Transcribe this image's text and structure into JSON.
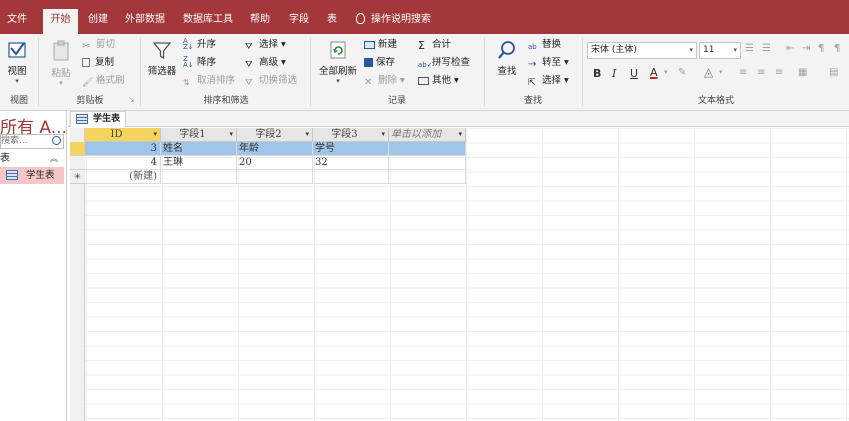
{
  "tabs": [
    {
      "label": "文件",
      "active": false
    },
    {
      "label": "开始",
      "active": true
    },
    {
      "label": "创建",
      "active": false
    },
    {
      "label": "外部数据",
      "active": false
    },
    {
      "label": "数据库工具",
      "active": false
    },
    {
      "label": "帮助",
      "active": false
    },
    {
      "label": "字段",
      "active": false
    },
    {
      "label": "表",
      "active": false
    }
  ],
  "tell_me": "操作说明搜索",
  "ribbon": {
    "views": {
      "view": "视图",
      "group": "视图"
    },
    "clipboard": {
      "paste": "粘贴",
      "cut": "剪切",
      "copy": "复制",
      "format_painter": "格式刷",
      "group": "剪贴板"
    },
    "sort_filter": {
      "filter": "筛选器",
      "ascending": "升序",
      "descending": "降序",
      "remove_sort": "取消排序",
      "selection": "选择",
      "advanced": "高级",
      "toggle_filter": "切换筛选",
      "group": "排序和筛选"
    },
    "records": {
      "refresh_all": "全部刷新",
      "new": "新建",
      "save": "保存",
      "delete": "删除",
      "totals": "合计",
      "spelling": "拼写检查",
      "more": "其他",
      "group": "记录"
    },
    "find": {
      "find": "查找",
      "replace": "替换",
      "goto": "转至",
      "select": "选择",
      "group": "查找"
    },
    "text_format": {
      "font": "宋体 (主体)",
      "size": "11",
      "bold": "B",
      "italic": "I",
      "underline": "U",
      "font_color": "A",
      "group": "文本格式"
    }
  },
  "nav": {
    "title": "所有 A...",
    "search_placeholder": "搜索...",
    "group": "表",
    "items": [
      {
        "label": "学生表"
      }
    ]
  },
  "document_tab": "学生表",
  "datasheet": {
    "columns": [
      "ID",
      "字段1",
      "字段2",
      "字段3",
      "单击以添加"
    ],
    "rows": [
      {
        "id": "3",
        "f1": "姓名",
        "f2": "年龄",
        "f3": "学号"
      },
      {
        "id": "4",
        "f1": "王琳",
        "f2": "20",
        "f3": "32"
      }
    ],
    "new_row": "(新建)",
    "new_row_marker": "✳"
  },
  "colors": {
    "accent": "#a4373a",
    "selected_row": "#9fc5e8",
    "current_header": "#f4d35e"
  }
}
